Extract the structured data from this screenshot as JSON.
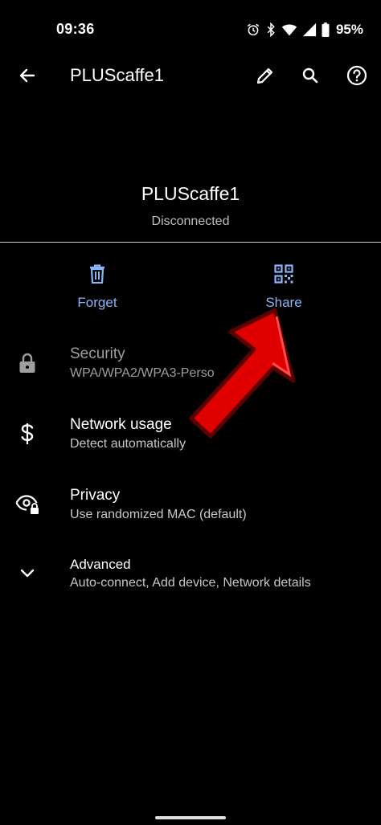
{
  "status_bar": {
    "time": "09:36",
    "battery": "95%",
    "icons": [
      "alarm-icon",
      "bluetooth-icon",
      "wifi-icon",
      "signal-icon",
      "battery-icon"
    ]
  },
  "app_bar": {
    "title": "PLUScaffe1",
    "icons": [
      "back-arrow-icon",
      "edit-pencil-icon",
      "search-icon",
      "help-icon"
    ]
  },
  "header": {
    "network_name": "PLUScaffe1",
    "status": "Disconnected"
  },
  "actions": [
    {
      "label": "Forget",
      "icon": "trash-icon"
    },
    {
      "label": "Share",
      "icon": "qr-code-icon"
    }
  ],
  "preferences": [
    {
      "title": "Security",
      "summary": "WPA/WPA2/WPA3-Perso",
      "icon": "lock-icon"
    },
    {
      "title": "Network usage",
      "summary": "Detect automatically",
      "icon": "dollar-icon"
    },
    {
      "title": "Privacy",
      "summary": "Use randomized MAC (default)",
      "icon": "eye-lock-icon"
    },
    {
      "title": "Advanced",
      "summary": "Auto-connect, Add device, Network details",
      "icon": "chevron-down-icon"
    }
  ],
  "colors": {
    "background": "#000000",
    "accent": "#8ab4f8",
    "arrow_annotation": "#e00000"
  }
}
